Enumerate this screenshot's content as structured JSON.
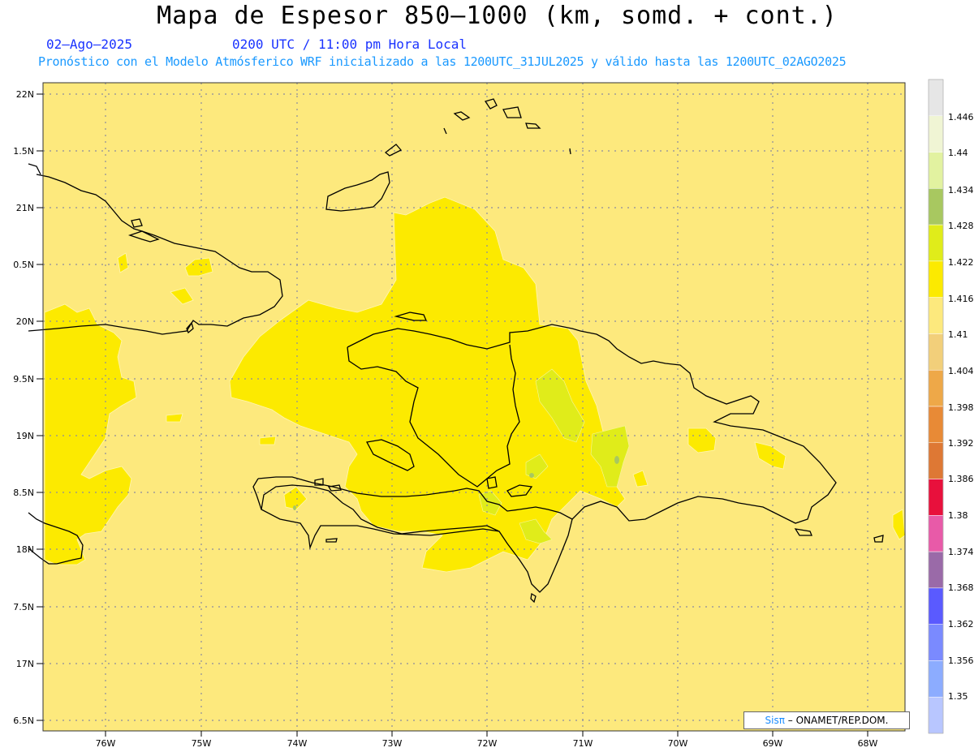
{
  "header": {
    "title": "Mapa de Espesor 850–1000 (km, somd. + cont.)",
    "date": "02–Ago–2025",
    "time": "0200 UTC / 11:00 pm Hora Local",
    "subtitle": "Pronóstico con el Modelo Atmósferico WRF inicializado a las 1200UTC_31JUL2025 y válido hasta las  1200UTC_02AGO2025"
  },
  "map": {
    "lat_labels": [
      "22N",
      "1.5N",
      "21N",
      "0.5N",
      "20N",
      "9.5N",
      "19N",
      "8.5N",
      "18N",
      "7.5N",
      "17N",
      "6.5N"
    ],
    "lon_labels": [
      "76W",
      "75W",
      "74W",
      "73W",
      "72W",
      "71W",
      "70W",
      "69W",
      "68W"
    ],
    "background_color": "#fde97d",
    "highlight_color": "#fcea00"
  },
  "colorbar": {
    "labels": [
      "1.446",
      "1.44",
      "1.434",
      "1.428",
      "1.422",
      "1.416",
      "1.41",
      "1.404",
      "1.398",
      "1.392",
      "1.386",
      "1.38",
      "1.374",
      "1.368",
      "1.362",
      "1.356",
      "1.35"
    ],
    "colors": [
      "#e6e6e6",
      "#f0f5d4",
      "#e2f2a0",
      "#a8c860",
      "#e0ec1a",
      "#fcea00",
      "#fde97d",
      "#f2cf7a",
      "#eea848",
      "#e88a36",
      "#de7834",
      "#e8103c",
      "#e85aa8",
      "#9a6aa8",
      "#5a5aff",
      "#7a8aff",
      "#8cacff",
      "#b8c6ff"
    ]
  },
  "credit": {
    "brand": "Sisπ",
    "text": "– ONAMET/REP.DOM."
  }
}
